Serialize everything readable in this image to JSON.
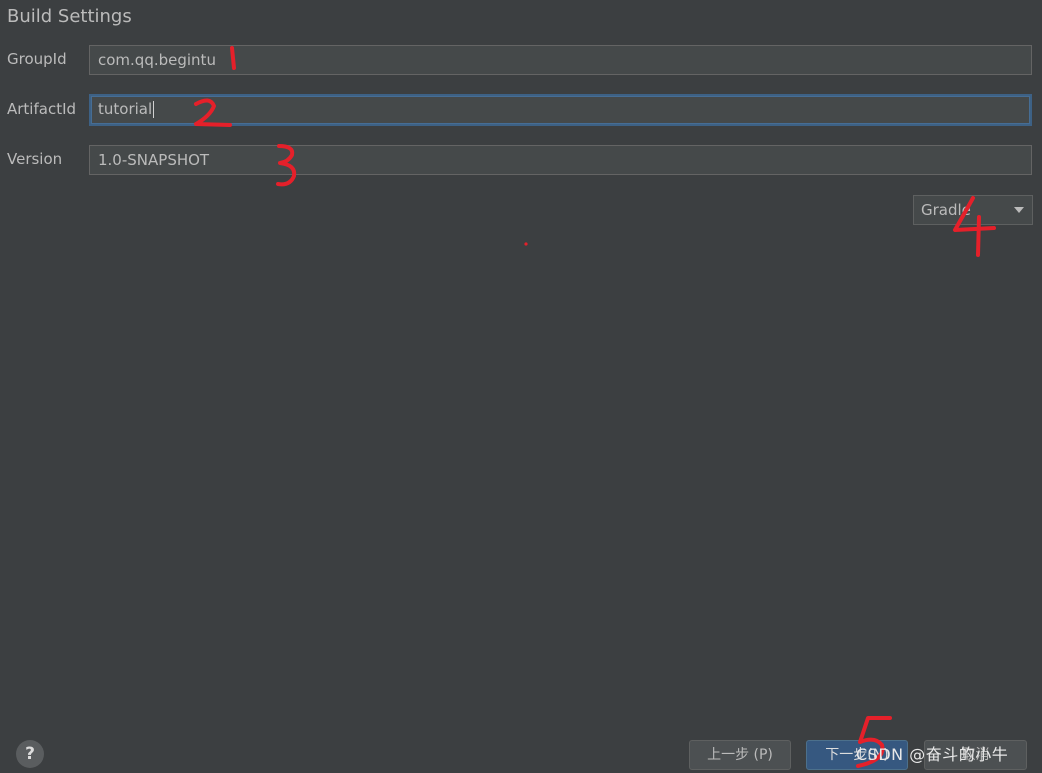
{
  "section": {
    "title": "Build Settings"
  },
  "fields": [
    {
      "label": "GroupId",
      "value": "com.qq.begintu"
    },
    {
      "label": "ArtifactId",
      "value": "tutorial"
    },
    {
      "label": "Version",
      "value": "1.0-SNAPSHOT"
    }
  ],
  "build_system": {
    "selected": "Gradle",
    "icon": "chevron-down-icon"
  },
  "footer": {
    "help": "?",
    "prev_label": "上一步 (P)",
    "next_label": "下一步(N)",
    "cancel_label": "取消"
  },
  "annotations": [
    "1",
    "2",
    "3",
    "4",
    "5"
  ],
  "watermark": "CSDN @奋斗的小牛",
  "colors": {
    "background": "#3c3f41",
    "field_bg": "#45494a",
    "focus_border": "#3d6185",
    "primary_button": "#365880",
    "annotation": "#e5202a"
  }
}
